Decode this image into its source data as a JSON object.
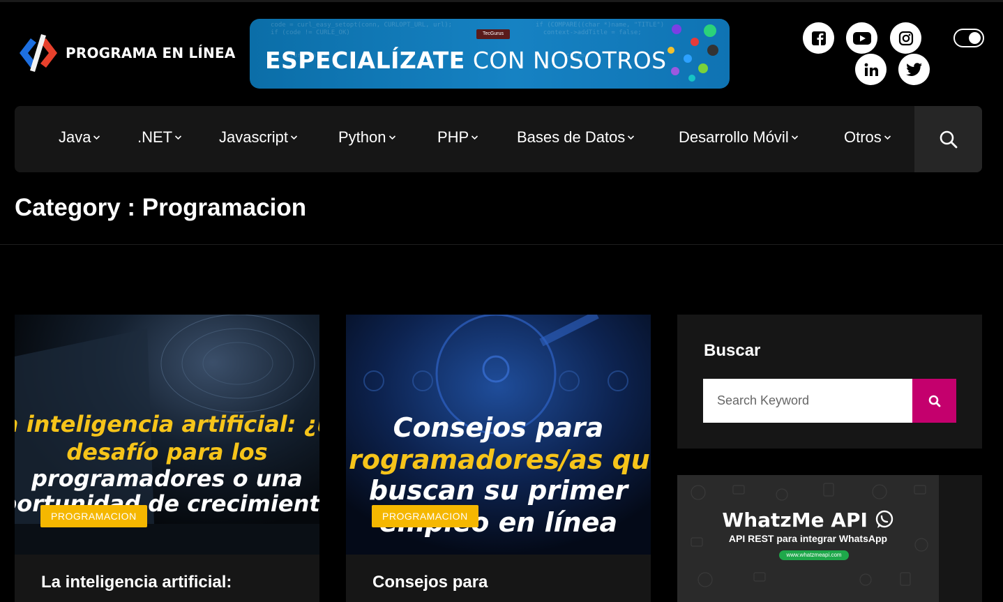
{
  "site": {
    "logo_text": "PROGRAMA EN LÍNEA"
  },
  "banner": {
    "brand": "TecGurus",
    "headline_bold": "ESPECIALÍZATE",
    "headline_rest": "CON NOSOTROS"
  },
  "social": [
    {
      "name": "facebook",
      "icon": "facebook-icon"
    },
    {
      "name": "youtube",
      "icon": "youtube-icon"
    },
    {
      "name": "instagram",
      "icon": "instagram-icon"
    },
    {
      "name": "linkedin",
      "icon": "linkedin-icon"
    },
    {
      "name": "twitter",
      "icon": "twitter-icon"
    }
  ],
  "nav": {
    "items": [
      "Java",
      ".NET",
      "Javascript",
      "Python",
      "PHP",
      "Bases de Datos",
      "Desarrollo Móvil",
      "Otros"
    ]
  },
  "page": {
    "title": "Category : Programacion"
  },
  "posts": [
    {
      "image_lines": [
        "a inteligencia artificial: ¿u",
        "desafío para los",
        "programadores o una",
        "portunidad de crecimiento"
      ],
      "category": "PROGRAMACION",
      "title": "La inteligencia artificial:"
    },
    {
      "image_lines": [
        "Consejos para",
        "rogramadores/as qu",
        "buscan su primer",
        "empleo en línea"
      ],
      "category": "PROGRAMACION",
      "title": "Consejos para"
    }
  ],
  "sidebar": {
    "search_title": "Buscar",
    "search_placeholder": "Search Keyword",
    "ad_title": "WhatzMe API",
    "ad_subtitle": "API REST para integrar WhatsApp",
    "ad_url": "www.whatzmeapi.com"
  },
  "colors": {
    "accent": "#c4006d",
    "badge": "#f5b700",
    "banner": "#1682c3"
  }
}
